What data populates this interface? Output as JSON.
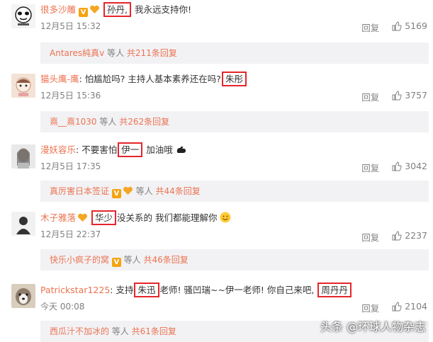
{
  "comments": [
    {
      "username": "很多沙雕",
      "text_before": "",
      "highlight": "孙丹,",
      "text_after": " 我永远支持你!",
      "time": "12月5日 15:32",
      "reply_label": "回复",
      "likes": "5169",
      "sub": {
        "name": "Antares純真v",
        "mid": " 等人 ",
        "count": "共211条回复"
      }
    },
    {
      "username": "猫头鹰-鹰",
      "text_before": ": 怕尴尬吗? 主持人基本素养还在吗?",
      "highlight": "朱彤",
      "text_after": "",
      "time": "12月5日 15:36",
      "reply_label": "回复",
      "likes": "3757",
      "sub": {
        "name": "熹__熹1030",
        "mid": " 等人 ",
        "count": "共262条回复"
      }
    },
    {
      "username": "漫妖容乐",
      "text_before": ": 不要害怕",
      "highlight": "伊一",
      "text_after": " 加油哦",
      "time": "12月5日 17:35",
      "reply_label": "回复",
      "likes": "3042",
      "sub": {
        "name": "真厉害日本签证",
        "mid": " 等人 ",
        "count": "共44条回复"
      }
    },
    {
      "username": "木子雅落",
      "text_before": " ",
      "highlight": "华少",
      "text_after": "没关系的 我们都能理解你",
      "time": "12月5日 22:37",
      "reply_label": "回复",
      "likes": "2237",
      "sub": {
        "name": "快乐小疯子的窝",
        "mid": " 等人 ",
        "count": "共46条回复"
      }
    },
    {
      "username": "Patrickstar1225",
      "text_before": ": 支持",
      "highlight": "朱迅",
      "text_after": "老师! 骚凹瑞~~伊一老师! 你自己来吧,",
      "highlight2": "周丹丹",
      "time": "今天 00:08",
      "reply_label": "回复",
      "likes": "2104",
      "sub": {
        "name": "西瓜汁不加冰的",
        "mid": " 等人 ",
        "count": "共61条回复"
      }
    }
  ],
  "watermark": "头条 @环球人物杂志",
  "colors": {
    "username": "#eb7350",
    "highlight_border": "#e5262b",
    "subbar_bg": "#f2f2f5",
    "meta": "#808080",
    "badge": "#f6a30f"
  }
}
